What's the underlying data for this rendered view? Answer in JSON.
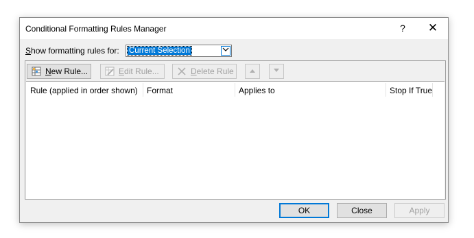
{
  "dialog": {
    "title": "Conditional Formatting Rules Manager",
    "help_glyph": "?",
    "close_glyph": "✕"
  },
  "filter": {
    "label_prefix": "S",
    "label_rest": "how formatting rules for:",
    "selected": "Current Selection"
  },
  "toolbar": {
    "new_rule_prefix": "N",
    "new_rule_rest": "ew Rule...",
    "edit_rule_prefix": "E",
    "edit_rule_rest": "dit Rule...",
    "delete_rule_prefix": "D",
    "delete_rule_rest": "elete Rule",
    "move_up_icon": "up-arrow-icon",
    "move_down_icon": "down-arrow-icon"
  },
  "table": {
    "columns": [
      "Rule (applied in order shown)",
      "Format",
      "Applies to",
      "Stop If True"
    ],
    "rows": []
  },
  "footer": {
    "ok": "OK",
    "close": "Close",
    "apply": "Apply"
  },
  "colors": {
    "accent": "#0078d7",
    "dialog_bg": "#f0f0f0",
    "disabled_text": "#a0a0a0"
  }
}
